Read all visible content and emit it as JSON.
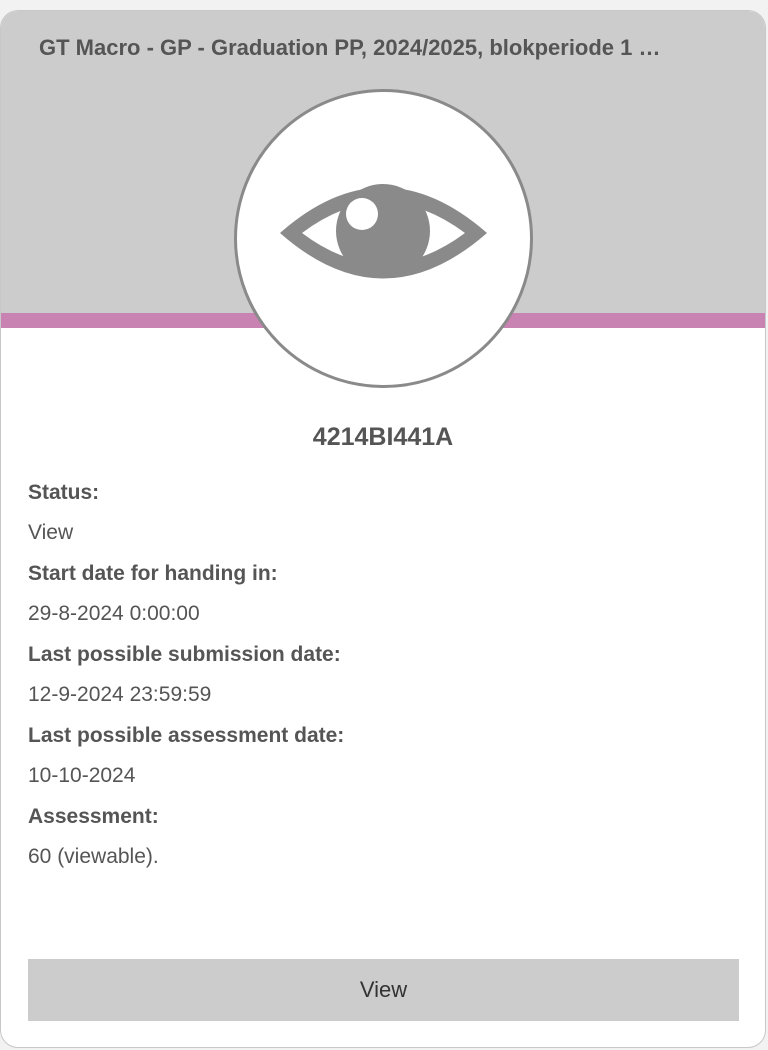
{
  "card": {
    "title": "GT Macro - GP - Graduation PP, 2024/2025, blokperiode 1 …",
    "code": "4214BI441A",
    "icon": "eye-icon",
    "colors": {
      "header_bg": "#cccccc",
      "accent": "#c983b3",
      "icon": "#8a8a8a"
    },
    "details": [
      {
        "label": "Status:",
        "value": "View"
      },
      {
        "label": "Start date for handing in:",
        "value": "29-8-2024 0:00:00"
      },
      {
        "label": "Last possible submission date:",
        "value": "12-9-2024 23:59:59"
      },
      {
        "label": "Last possible assessment date:",
        "value": "10-10-2024"
      },
      {
        "label": "Assessment:",
        "value": "60 (viewable)."
      }
    ],
    "button_label": "View"
  }
}
